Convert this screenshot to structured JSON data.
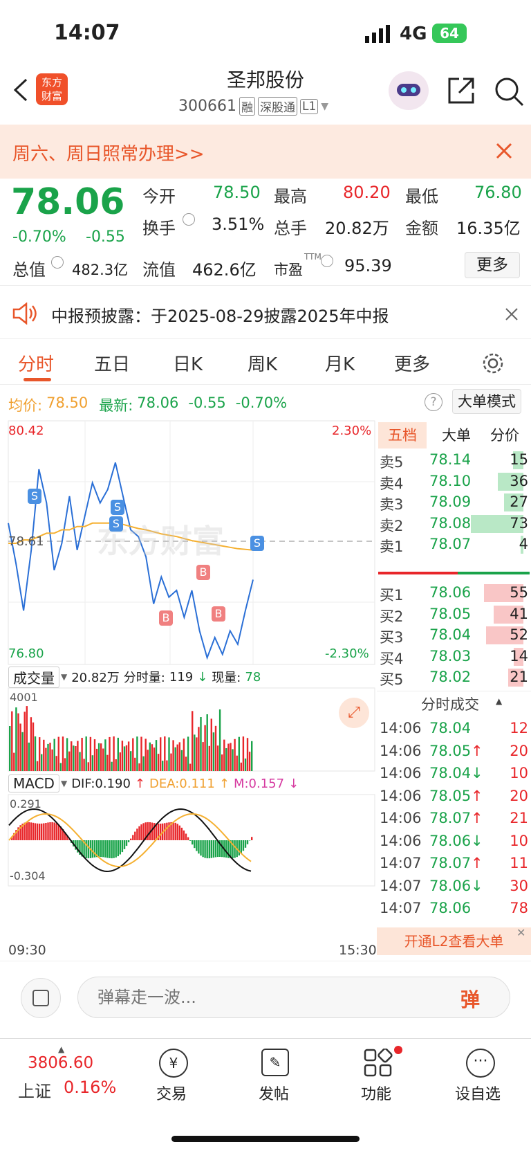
{
  "status": {
    "time": "14:07",
    "network": "4G",
    "battery": "64"
  },
  "header": {
    "title": "圣邦股份",
    "code": "300661",
    "tags": [
      "融",
      "深股通",
      "L1"
    ]
  },
  "banner": {
    "text": "周六、周日照常办理>>"
  },
  "quote": {
    "price": "78.06",
    "change_pct": "-0.70%",
    "change": "-0.55",
    "open_label": "今开",
    "open": "78.50",
    "high_label": "最高",
    "high": "80.20",
    "low_label": "最低",
    "low": "76.80",
    "turnover_label": "换手",
    "turnover": "3.51%",
    "volume_label": "总手",
    "volume": "20.82万",
    "amount_label": "金额",
    "amount": "16.35亿",
    "mktcap_label": "总值",
    "mktcap": "482.3亿",
    "float_label": "流值",
    "float": "462.6亿",
    "pe_label": "市盈",
    "pe_sup": "TTM",
    "pe": "95.39",
    "more": "更多"
  },
  "notice": {
    "text": "中报预披露：于2025-08-29披露2025年中报"
  },
  "tabs": [
    "分时",
    "五日",
    "日K",
    "周K",
    "月K",
    "更多"
  ],
  "chart_info": {
    "avg_label": "均价:",
    "avg": "78.50",
    "latest_label": "最新:",
    "latest": "78.06",
    "change": "-0.55",
    "pct": "-0.70%",
    "mode": "大单模式"
  },
  "price_chart": {
    "max": "80.42",
    "min": "76.80",
    "prev": "78.61",
    "pct_max": "2.30%",
    "pct_min": "-2.30%",
    "watermark": "东方财富"
  },
  "volume_panel": {
    "label": "成交量",
    "total": "20.82万",
    "tick_label": "分时量:",
    "tick": "119",
    "now_label": "现量:",
    "now": "78",
    "max": "4001"
  },
  "macd_panel": {
    "label": "MACD",
    "dif": "DIF:0.190",
    "dea": "DEA:0.111",
    "m": "M:0.157",
    "max": "0.291",
    "min": "-0.304"
  },
  "time_axis": {
    "start": "09:30",
    "end": "15:30"
  },
  "order_tabs": [
    "五档",
    "大单",
    "分价"
  ],
  "sells": [
    {
      "label": "卖5",
      "price": "78.14",
      "vol": "15",
      "share": 0.2
    },
    {
      "label": "卖4",
      "price": "78.10",
      "vol": "36",
      "share": 0.49
    },
    {
      "label": "卖3",
      "price": "78.09",
      "vol": "27",
      "share": 0.37
    },
    {
      "label": "卖2",
      "price": "78.08",
      "vol": "73",
      "share": 1.0
    },
    {
      "label": "卖1",
      "price": "78.07",
      "vol": "4",
      "share": 0.05
    }
  ],
  "buys": [
    {
      "label": "买1",
      "price": "78.06",
      "vol": "55",
      "share": 0.75
    },
    {
      "label": "买2",
      "price": "78.05",
      "vol": "41",
      "share": 0.56
    },
    {
      "label": "买3",
      "price": "78.04",
      "vol": "52",
      "share": 0.71
    },
    {
      "label": "买4",
      "price": "78.03",
      "vol": "14",
      "share": 0.19
    },
    {
      "label": "买5",
      "price": "78.02",
      "vol": "21",
      "share": 0.29
    }
  ],
  "trades_title": "分时成交",
  "trades": [
    {
      "time": "14:06",
      "price": "78.04",
      "arrow": "",
      "vol": "12"
    },
    {
      "time": "14:06",
      "price": "78.05",
      "arrow": "↑",
      "vol": "20"
    },
    {
      "time": "14:06",
      "price": "78.04",
      "arrow": "↓",
      "vol": "10"
    },
    {
      "time": "14:06",
      "price": "78.05",
      "arrow": "↑",
      "vol": "20"
    },
    {
      "time": "14:06",
      "price": "78.07",
      "arrow": "↑",
      "vol": "21"
    },
    {
      "time": "14:06",
      "price": "78.06",
      "arrow": "↓",
      "vol": "10"
    },
    {
      "time": "14:07",
      "price": "78.07",
      "arrow": "↑",
      "vol": "11"
    },
    {
      "time": "14:07",
      "price": "78.06",
      "arrow": "↓",
      "vol": "30"
    },
    {
      "time": "14:07",
      "price": "78.06",
      "arrow": "",
      "vol": "78"
    }
  ],
  "l2_cta": "开通L2查看大单",
  "danmu": {
    "placeholder": "弹幕走一波...",
    "send": "弹"
  },
  "bottom": {
    "index_value": "3806.60",
    "index_name": "上证",
    "index_pct": "0.16%",
    "trade": "交易",
    "post": "发帖",
    "func": "功能",
    "watch": "设自选"
  },
  "chart_data": {
    "type": "line",
    "xlabel": "",
    "ylabel": "",
    "x_range": [
      "09:30",
      "15:30"
    ],
    "ylim": [
      76.8,
      80.42
    ],
    "series": [
      {
        "name": "",
        "values": [
          78.9,
          78.3,
          77.6,
          78.5,
          79.7,
          79.2,
          78.2,
          78.6,
          79.3,
          78.5,
          79.0,
          79.5,
          79.2,
          79.4,
          79.8,
          79.3,
          78.8,
          78.7,
          78.4,
          77.7,
          78.1,
          77.8,
          77.9,
          77.5,
          77.9,
          77.3,
          76.9,
          77.2,
          76.95,
          77.3,
          77.1,
          77.6,
          78.06
        ]
      },
      {
        "name": "均价",
        "values": [
          78.6,
          78.6,
          78.65,
          78.65,
          78.7,
          78.75,
          78.75,
          78.8,
          78.8,
          78.85,
          78.85,
          78.9,
          78.9,
          78.9,
          78.9,
          78.88,
          78.85,
          78.82,
          78.8,
          78.77,
          78.74,
          78.72,
          78.7,
          78.67,
          78.64,
          78.62,
          78.6,
          78.58,
          78.56,
          78.54,
          78.52,
          78.51,
          78.5
        ]
      }
    ]
  }
}
